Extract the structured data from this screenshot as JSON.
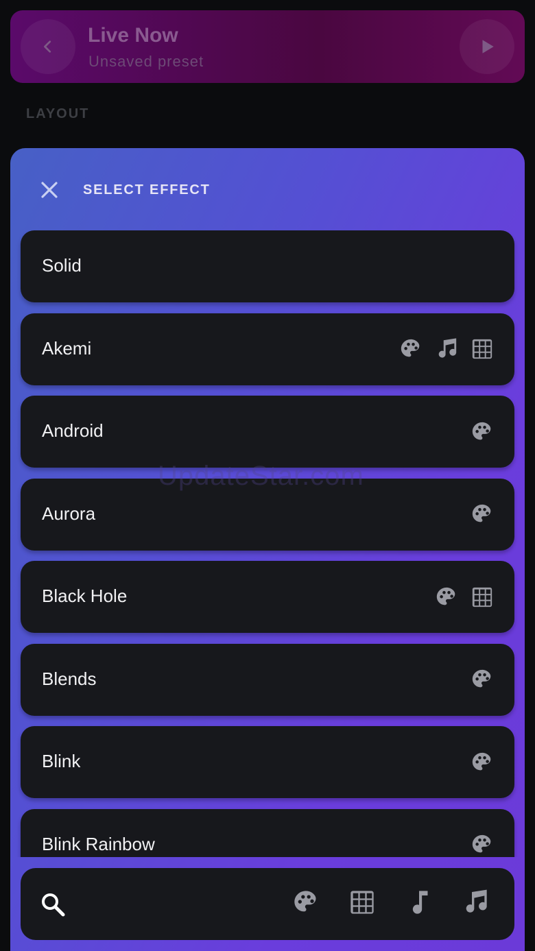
{
  "preset": {
    "title": "Live Now",
    "subtitle": "Unsaved preset"
  },
  "section": {
    "layout_label": "LAYOUT"
  },
  "modal": {
    "title": "SELECT EFFECT"
  },
  "effects": [
    {
      "name": "Solid",
      "icons": []
    },
    {
      "name": "Akemi",
      "icons": [
        "palette-icon",
        "music-note-icon",
        "grid-icon"
      ]
    },
    {
      "name": "Android",
      "icons": [
        "palette-icon"
      ]
    },
    {
      "name": "Aurora",
      "icons": [
        "palette-icon"
      ]
    },
    {
      "name": "Black Hole",
      "icons": [
        "palette-icon",
        "grid-icon"
      ]
    },
    {
      "name": "Blends",
      "icons": [
        "palette-icon"
      ]
    },
    {
      "name": "Blink",
      "icons": [
        "palette-icon"
      ]
    },
    {
      "name": "Blink Rainbow",
      "icons": [
        "palette-icon"
      ]
    }
  ],
  "filters": [
    "palette-icon",
    "grid-icon",
    "single-note-icon",
    "music-note-icon"
  ],
  "watermark": "UpdateStar.com",
  "colors": {
    "icon_gray": "#9a9ba3",
    "card_bg": "#17181c"
  }
}
